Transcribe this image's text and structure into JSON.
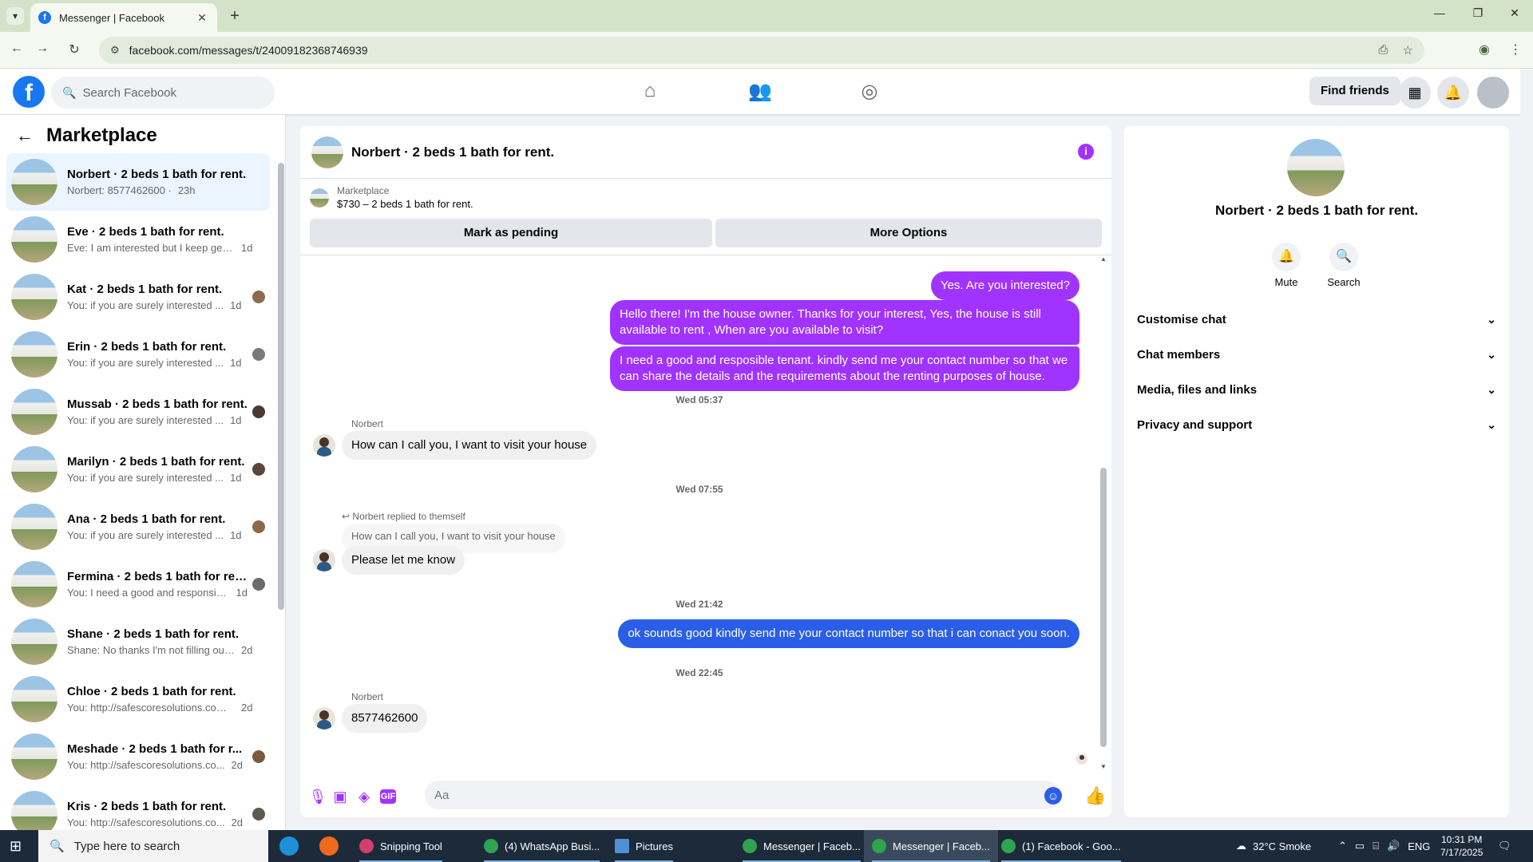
{
  "browser": {
    "tab_title": "Messenger | Facebook",
    "url": "facebook.com/messages/t/24009182368746939"
  },
  "fb": {
    "logo": "f",
    "search_placeholder": "Search Facebook",
    "find_friends": "Find friends"
  },
  "left": {
    "title": "Marketplace",
    "conversations": [
      {
        "name": "Norbert · 2 beds 1 bath for rent.",
        "preview": "Norbert: 8577462600 ·",
        "time": "23h",
        "active": true
      },
      {
        "name": "Eve · 2 beds 1 bath for rent.",
        "preview": "Eve: I am interested but I keep getti...",
        "time": "1d"
      },
      {
        "name": "Kat · 2 beds 1 bath for rent.",
        "preview": "You: if you are surely interested ...",
        "time": "1d"
      },
      {
        "name": "Erin · 2 beds 1 bath for rent.",
        "preview": "You: if you are surely interested ...",
        "time": "1d"
      },
      {
        "name": "Mussab · 2 beds 1 bath for rent.",
        "preview": "You: if you are surely interested ...",
        "time": "1d"
      },
      {
        "name": "Marilyn · 2 beds 1 bath for rent.",
        "preview": "You: if you are surely interested ...",
        "time": "1d"
      },
      {
        "name": "Ana · 2 beds 1 bath for rent.",
        "preview": "You: if you are surely interested ...",
        "time": "1d"
      },
      {
        "name": "Fermina · 2 beds 1 bath for rent.",
        "preview": "You: I need a good and responsibl...",
        "time": "1d"
      },
      {
        "name": "Shane · 2 beds 1 bath for rent.",
        "preview": "Shane: No thanks I'm not filling out...",
        "time": "2d"
      },
      {
        "name": "Chloe · 2 beds 1 bath for rent.",
        "preview": "You: http://safescoresolutions.com/...",
        "time": "2d"
      },
      {
        "name": "Meshade · 2 beds 1 bath for r...",
        "preview": "You: http://safescoresolutions.co...",
        "time": "2d"
      },
      {
        "name": "Kris · 2 beds 1 bath for rent.",
        "preview": "You: http://safescoresolutions.co...",
        "time": "2d"
      }
    ]
  },
  "chat": {
    "title": "Norbert · 2 beds 1 bath for rent.",
    "marketplace_label": "Marketplace",
    "listing": "$730 – 2 beds 1 bath for rent.",
    "mark_pending": "Mark as pending",
    "more_options": "More Options",
    "msg1": "Yes. Are you interested?",
    "msg2": "Hello there! I'm the house owner. Thanks for your interest, Yes, the house is still available to rent , When are you available to visit?",
    "msg3": "I need a good and resposible tenant.  kindly send me your contact number so that we can share the details and the requirements about the renting purposes of house.",
    "stamp1": "Wed 05:37",
    "sender": "Norbert",
    "msg4": "How can I call you, I want to visit your house",
    "stamp2": "Wed 07:55",
    "reply_label": "Norbert replied to themself",
    "quoted": "How can I call you, I want to visit your house",
    "msg5": "Please let me know",
    "stamp3": "Wed 21:42",
    "msg6": "ok sounds good kindly  send me your contact number so that i can conact you soon.",
    "stamp4": "Wed 22:45",
    "msg7": "8577462600",
    "input_placeholder": "Aa",
    "colors": {
      "accent": "#a033ff",
      "blue": "#2a5ee8"
    }
  },
  "right": {
    "name": "Norbert · 2 beds 1 bath for rent.",
    "mute": "Mute",
    "search": "Search",
    "sections": [
      "Customise chat",
      "Chat members",
      "Media, files and links",
      "Privacy and support"
    ]
  },
  "taskbar": {
    "search_placeholder": "Type here to search",
    "apps": [
      "Snipping Tool",
      "(4) WhatsApp Busi...",
      "Pictures",
      "Messenger | Faceb...",
      "Messenger | Faceb...",
      "(1) Facebook - Goo..."
    ],
    "weather": "32°C  Smoke",
    "lang": "ENG",
    "time": "10:31 PM",
    "date": "7/17/2025"
  }
}
